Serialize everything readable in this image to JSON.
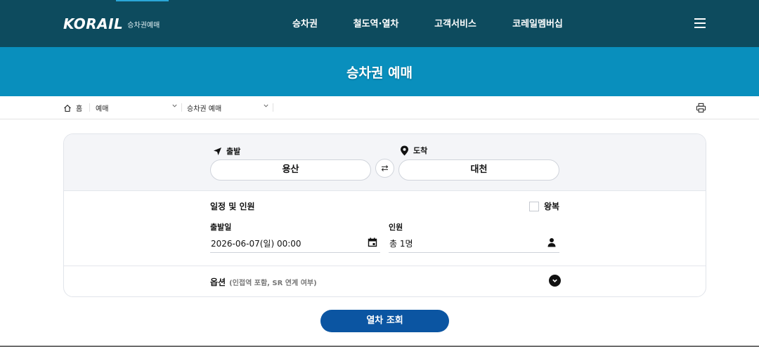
{
  "header": {
    "logo_text": "KORAIL",
    "logo_sub": "승차권예매",
    "nav": [
      "승차권",
      "철도역·열차",
      "고객서비스",
      "코레일멤버십"
    ]
  },
  "banner": {
    "title": "승차권 예매"
  },
  "breadcrumb": {
    "home": "홈",
    "level1": "예매",
    "level2": "승차권 예매"
  },
  "route": {
    "departure_label": "출발",
    "departure_value": "용산",
    "arrival_label": "도착",
    "arrival_value": "대천"
  },
  "schedule": {
    "title": "일정 및 인원",
    "roundtrip_label": "왕복",
    "date_label": "출발일",
    "date_value": "2026-06-07(일) 00:00",
    "people_label": "인원",
    "people_value": "총 1명"
  },
  "options": {
    "label": "옵션",
    "hint": "(인접역 포함, SR 연계 여부)"
  },
  "search_button": "열차 조회",
  "colors": {
    "topbar": "#0d4b5e",
    "banner": "#098fbd",
    "button": "#0b55a2"
  }
}
